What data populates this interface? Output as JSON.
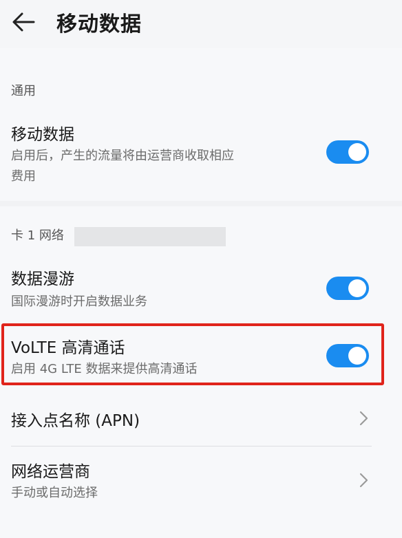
{
  "header": {
    "title": "移动数据"
  },
  "general": {
    "label": "通用",
    "mobile_data": {
      "title": "移动数据",
      "subtitle_line1": "启用后，产生的流量将由运营商收取相应",
      "subtitle_line2": "费用",
      "enabled": true
    }
  },
  "sim1": {
    "label": "卡 1 网络",
    "roaming": {
      "title": "数据漫游",
      "subtitle": "国际漫游时开启数据业务",
      "enabled": true
    },
    "volte": {
      "title": "VoLTE 高清通话",
      "subtitle": "启用 4G LTE 数据来提供高清通话",
      "enabled": true
    },
    "apn": {
      "title": "接入点名称 (APN)"
    },
    "operator": {
      "title": "网络运营商",
      "subtitle": "手动或自动选择"
    }
  },
  "colors": {
    "accent": "#1a8cf0",
    "highlight_border": "#e0241b",
    "background": "#f1f2f4"
  },
  "icons": {
    "back": "arrow-left-icon",
    "chevron": "chevron-right-icon"
  }
}
